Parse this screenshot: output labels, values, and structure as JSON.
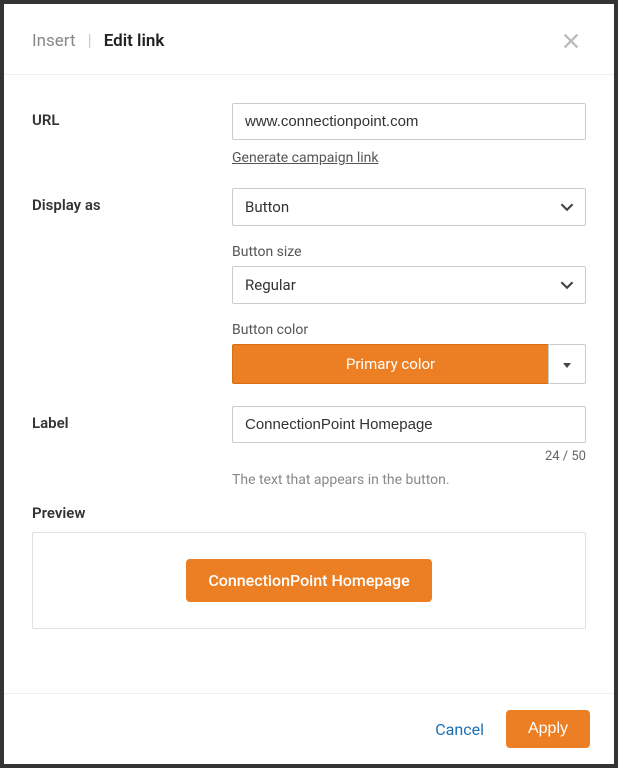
{
  "header": {
    "tab_insert": "Insert",
    "tab_edit": "Edit link"
  },
  "url": {
    "label": "URL",
    "value": "www.connectionpoint.com",
    "generate_link": "Generate campaign link"
  },
  "display_as": {
    "label": "Display as",
    "value": "Button"
  },
  "button_size": {
    "label": "Button size",
    "value": "Regular"
  },
  "button_color": {
    "label": "Button color",
    "value": "Primary color"
  },
  "label_field": {
    "label": "Label",
    "value": "ConnectionPoint Homepage",
    "counter": "24 / 50",
    "helper": "The text that appears in the button."
  },
  "preview": {
    "label": "Preview",
    "button_text": "ConnectionPoint Homepage"
  },
  "footer": {
    "cancel": "Cancel",
    "apply": "Apply"
  }
}
